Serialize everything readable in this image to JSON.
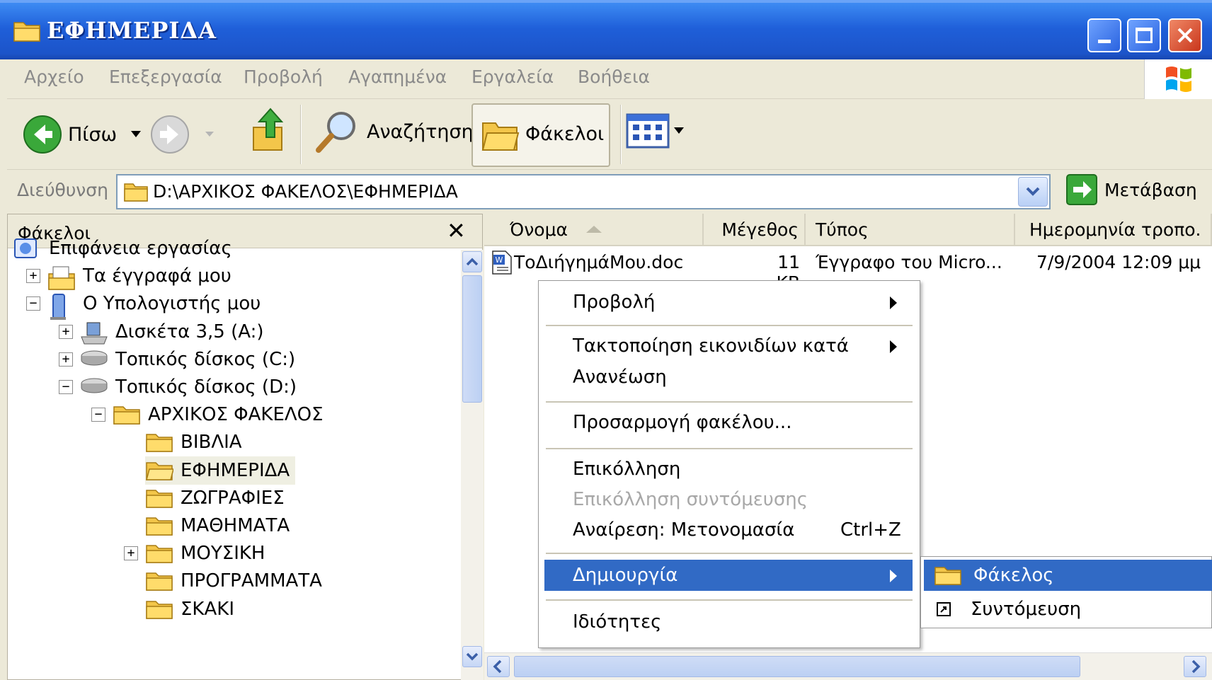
{
  "window": {
    "title": "ΕΦΗΜΕΡΙΔΑ"
  },
  "menubar": {
    "items": [
      "Αρχείο",
      "Επεξεργασία",
      "Προβολή",
      "Αγαπημένα",
      "Εργαλεία",
      "Βοήθεια"
    ]
  },
  "toolbar": {
    "back_label": "Πίσω",
    "search_label": "Αναζήτηση",
    "folders_label": "Φάκελοι"
  },
  "address": {
    "label": "Διεύθυνση",
    "value": "D:\\ΑΡΧΙΚΟΣ ΦΑΚΕΛΟΣ\\ΕΦΗΜΕΡΙΔΑ",
    "go_label": "Μετάβαση"
  },
  "folders_pane": {
    "title": "Φάκελοι",
    "close_glyph": "✕",
    "tree": [
      {
        "label": "Επιφάνεια εργασίας",
        "icon": "desktop-icon",
        "expander": ""
      },
      {
        "label": "Τα έγγραφά μου",
        "icon": "my-documents-icon",
        "expander": "+"
      },
      {
        "label": "Ο Υπολογιστής μου",
        "icon": "my-computer-icon",
        "expander": "−"
      },
      {
        "label": "Δισκέτα 3,5 (A:)",
        "icon": "floppy-drive-icon",
        "expander": "+"
      },
      {
        "label": "Τοπικός δίσκος (C:)",
        "icon": "hard-drive-icon",
        "expander": "+"
      },
      {
        "label": "Τοπικός δίσκος (D:)",
        "icon": "hard-drive-icon",
        "expander": "−"
      },
      {
        "label": "ΑΡΧΙΚΟΣ ΦΑΚΕΛΟΣ",
        "icon": "folder-icon",
        "expander": "−"
      },
      {
        "label": "ΒΙΒΛΙΑ",
        "icon": "folder-icon",
        "expander": ""
      },
      {
        "label": "ΕΦΗΜΕΡΙΔΑ",
        "icon": "folder-open-icon",
        "expander": ""
      },
      {
        "label": "ΖΩΓΡΑΦΙΕΣ",
        "icon": "folder-icon",
        "expander": ""
      },
      {
        "label": "ΜΑΘΗΜΑΤΑ",
        "icon": "folder-icon",
        "expander": ""
      },
      {
        "label": "ΜΟΥΣΙΚΗ",
        "icon": "folder-icon",
        "expander": "+"
      },
      {
        "label": "ΠΡΟΓΡΑΜΜΑΤΑ",
        "icon": "folder-icon",
        "expander": ""
      },
      {
        "label": "ΣΚΑΚΙ",
        "icon": "folder-icon",
        "expander": ""
      }
    ]
  },
  "file_list": {
    "columns": [
      "Όνομα",
      "Μέγεθος",
      "Τύπος",
      "Ημερομηνία τροπο."
    ],
    "rows": [
      {
        "name": "ΤοΔιήγημάΜου.doc",
        "size": "11 KB",
        "type": "Έγγραφο του Micro...",
        "date": "7/9/2004 12:09 μμ"
      }
    ]
  },
  "context_menu": {
    "view": "Προβολή",
    "arrange": "Τακτοποίηση εικονιδίων κατά",
    "refresh": "Ανανέωση",
    "customize": "Προσαρμογή φακέλου...",
    "paste": "Επικόλληση",
    "paste_shortcut": "Επικόλληση συντόμευσης",
    "undo": "Αναίρεση: Μετονομασία",
    "undo_key": "Ctrl+Z",
    "new": "Δημιουργία",
    "properties": "Ιδιότητες"
  },
  "submenu": {
    "folder": "Φάκελος",
    "shortcut": "Συντόμευση"
  }
}
